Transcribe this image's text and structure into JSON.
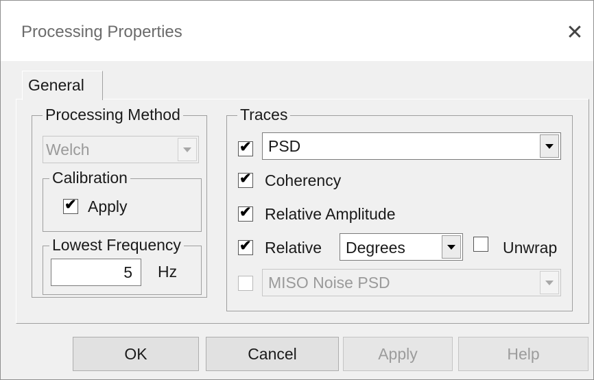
{
  "dialog": {
    "title": "Processing Properties",
    "close_glyph": "✕"
  },
  "tabs": [
    {
      "label": "General",
      "selected": true
    }
  ],
  "processing_method": {
    "group_label": "Processing Method",
    "method_value": "Welch",
    "method_enabled": false
  },
  "calibration": {
    "group_label": "Calibration",
    "apply_label": "Apply",
    "apply_checked": true
  },
  "lowest_frequency": {
    "group_label": "Lowest Frequency",
    "value": "5",
    "unit": "Hz"
  },
  "traces": {
    "group_label": "Traces",
    "psd": {
      "checked": true,
      "value": "PSD"
    },
    "coherency": {
      "checked": true,
      "label": "Coherency"
    },
    "relative_amplitude": {
      "checked": true,
      "label": "Relative Amplitude"
    },
    "relative": {
      "checked": true,
      "label": "Relative",
      "unit_value": "Degrees"
    },
    "unwrap": {
      "checked": false,
      "label": "Unwrap"
    },
    "miso": {
      "checked": false,
      "enabled": false,
      "value": "MISO Noise PSD"
    }
  },
  "buttons": {
    "ok": "OK",
    "cancel": "Cancel",
    "apply": "Apply",
    "help": "Help"
  },
  "icons": {
    "check_glyph": "✔"
  },
  "colors": {
    "dialog_bg": "#f0f0f0",
    "title_bar_bg": "#ffffff",
    "disabled_text": "#9a9a9a"
  }
}
